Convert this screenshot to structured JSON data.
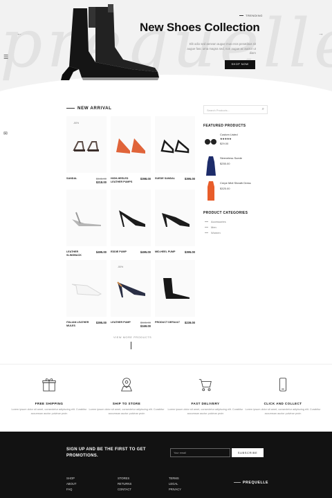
{
  "hero": {
    "script_text": "prequelle",
    "tag": "TRENDING",
    "title": "New Shoes Collection",
    "description": "Elit odio sed aenean augue mus eros penatibus sit augue fasc urna magna sed, non augue ac auctor ut diam",
    "button": "SHOP NOW"
  },
  "section": {
    "new_arrival": "NEW ARRIVAL"
  },
  "products": [
    {
      "name": "SANDAL",
      "old_price": "$445.00",
      "price": "$218.00",
      "badge": "-50%"
    },
    {
      "name": "HIGH-HEELED LEATHER PUMPS",
      "old_price": "",
      "price": "$398.00",
      "badge": ""
    },
    {
      "name": "SUEDE SANDAL",
      "old_price": "",
      "price": "$395.00",
      "badge": ""
    },
    {
      "name": "LEATHER SLINGBACK",
      "old_price": "",
      "price": "$495.00",
      "badge": ""
    },
    {
      "name": "EDDIE PUMP",
      "old_price": "",
      "price": "$495.00",
      "badge": ""
    },
    {
      "name": "MID-HEEL PUMP",
      "old_price": "",
      "price": "$395.00",
      "badge": ""
    },
    {
      "name": "ITALIAN LEATHER MULES",
      "old_price": "",
      "price": "$395.00",
      "badge": ""
    },
    {
      "name": "LEATHER PUMP",
      "old_price": "$345.00",
      "price": "$169.00",
      "badge": "-50%"
    },
    {
      "name": "PRODUCT DEFAULT",
      "old_price": "",
      "price": "$239.00",
      "badge": ""
    }
  ],
  "view_more": "VIEW MORE PRODUCTS",
  "sidebar": {
    "search_placeholder": "Search Products...",
    "featured_title": "FEATURED PRODUCTS",
    "featured": [
      {
        "name": "Custom Listed",
        "stars": "★★★★★",
        "price": "$29.00"
      },
      {
        "name": "Sleeveless Suede",
        "stars": "",
        "price": "$255.00"
      },
      {
        "name": "Crepe Midi Sheath Dress",
        "stars": "",
        "price": "$325.00"
      }
    ],
    "categories_title": "PRODUCT CATEGORIES",
    "categories": [
      "Accessories",
      "Men",
      "Women"
    ]
  },
  "features": [
    {
      "icon": "gift-icon",
      "title": "FREE SHIPPING",
      "desc": "Lorem ipsum dolor sit amet, consectetur adipiscing elit. Curabitur accumsan auctor pulvinar proin"
    },
    {
      "icon": "map-pin-icon",
      "title": "SHIP TO STORE",
      "desc": "Lorem ipsum dolor sit amet, consectetur adipiscing elit. Curabitur accumsan auctor pulvinar proin"
    },
    {
      "icon": "cart-icon",
      "title": "FAST DELIVERY",
      "desc": "Lorem ipsum dolor sit amet, consectetur adipiscing elit. Curabitur accumsan auctor pulvinar proin"
    },
    {
      "icon": "phone-icon",
      "title": "CLICK AND COLLECT",
      "desc": "Lorem ipsum dolor sit amet, consectetur adipiscing elit. Curabitur accumsan auctor pulvinar proin"
    }
  ],
  "footer": {
    "signup": "SIGN UP AND BE THE FIRST TO GET PROMOTIONS.",
    "email_placeholder": "Your email",
    "subscribe": "SUBSCRIBE",
    "col1": [
      "SHOP",
      "ABOUT",
      "FAQ"
    ],
    "col2": [
      "STORES",
      "RETURNS",
      "CONTACT"
    ],
    "col3": [
      "TERMS",
      "LEGAL",
      "PRIVACY"
    ],
    "brand": "PREQUELLE"
  }
}
